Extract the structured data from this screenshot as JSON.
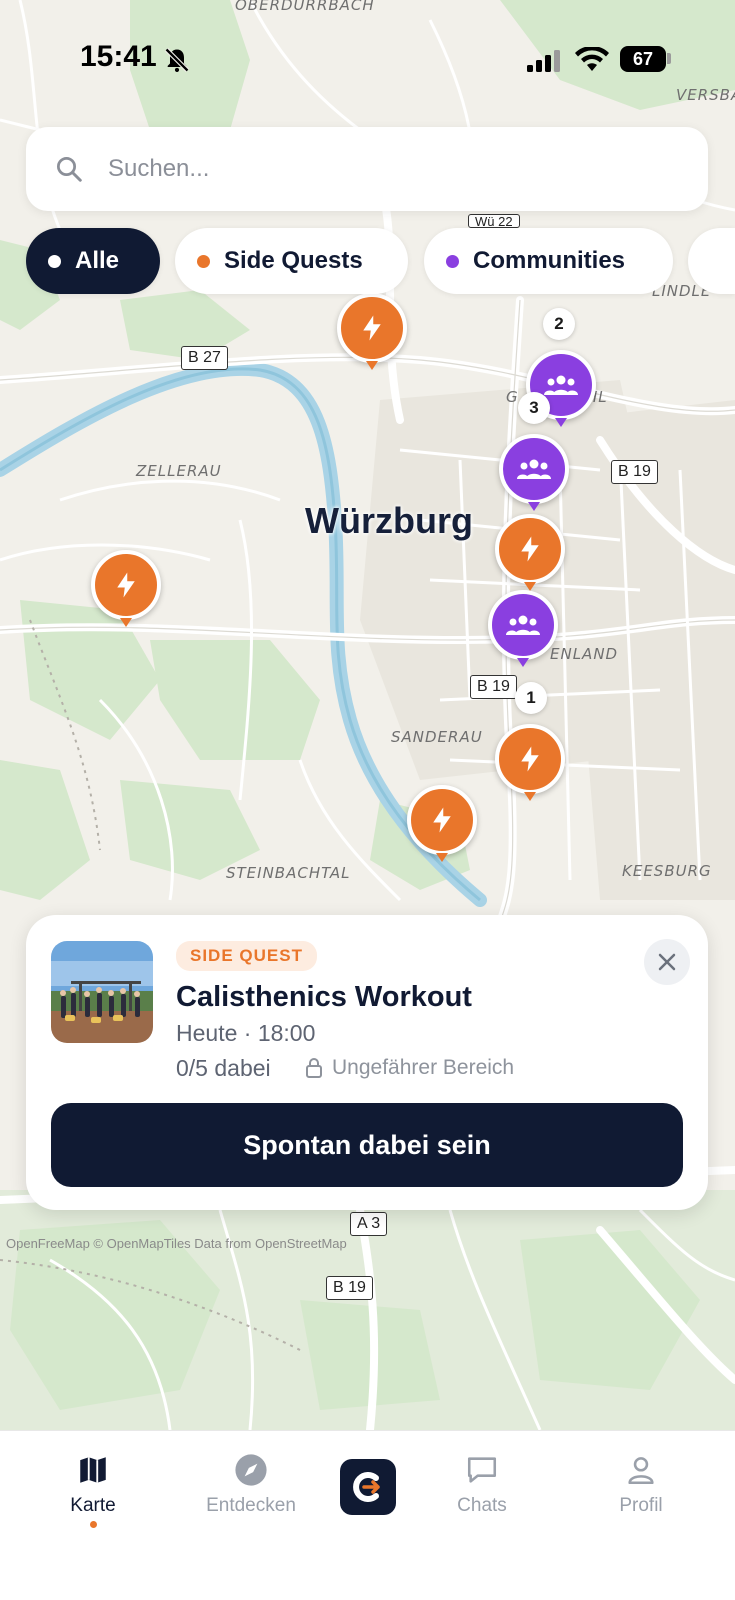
{
  "status_bar": {
    "time": "15:41",
    "battery": "67",
    "icons": [
      "bell-slash-icon",
      "signal-icon",
      "wifi-icon",
      "battery-icon"
    ]
  },
  "search": {
    "placeholder": "Suchen...",
    "icon": "search-icon"
  },
  "filters": [
    {
      "label": "Alle",
      "dot_color": "#ffffff",
      "active": true
    },
    {
      "label": "Side Quests",
      "dot_color": "#e9762b",
      "active": false
    },
    {
      "label": "Communities",
      "dot_color": "#8a3fe0",
      "active": false
    },
    {
      "label": "",
      "dot_color": "#3a4252",
      "active": false
    }
  ],
  "map": {
    "city": "Würzburg",
    "districts": [
      "OBERDÜRRBACH",
      "VERSBA",
      "LINDLE",
      "ZELLERAU",
      "ENLAND",
      "SANDERAU",
      "STEINBACHTAL",
      "KEESBURG",
      "G",
      "HL"
    ],
    "roads": [
      "B 27",
      "B 19",
      "B 19",
      "A 3",
      "B 19",
      "Wü 22"
    ],
    "attribution": "OpenFreeMap © OpenMapTiles Data from OpenStreetMap",
    "pins": [
      {
        "type": "quest",
        "icon": "bolt-icon"
      },
      {
        "type": "community",
        "icon": "group-icon",
        "badge": "2"
      },
      {
        "type": "community",
        "icon": "group-icon",
        "badge": "3"
      },
      {
        "type": "quest",
        "icon": "bolt-icon"
      },
      {
        "type": "quest",
        "icon": "bolt-icon"
      },
      {
        "type": "community",
        "icon": "group-icon",
        "badge": "1"
      },
      {
        "type": "quest",
        "icon": "bolt-icon"
      },
      {
        "type": "quest",
        "icon": "bolt-icon"
      }
    ]
  },
  "card": {
    "type_label": "SIDE QUEST",
    "title": "Calisthenics Workout",
    "time": "Heute · 18:00",
    "participants": "0/5 dabei",
    "area": "Ungefährer Bereich",
    "button": "Spontan dabei sein",
    "close_icon": "close-icon",
    "lock_icon": "lock-icon"
  },
  "tabs": [
    {
      "label": "Karte",
      "icon": "map-icon",
      "active": true
    },
    {
      "label": "Entdecken",
      "icon": "compass-icon",
      "active": false
    },
    {
      "label": "Chats",
      "icon": "chat-icon",
      "active": false
    },
    {
      "label": "Profil",
      "icon": "person-icon",
      "active": false
    }
  ],
  "colors": {
    "accent_orange": "#e9762b",
    "community_purple": "#8a3fe0",
    "navy": "#101a33"
  }
}
